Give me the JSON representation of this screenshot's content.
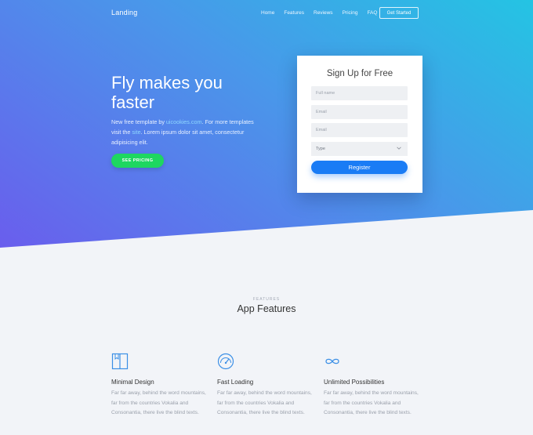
{
  "nav": {
    "brand": "Landing",
    "links": [
      "Home",
      "Features",
      "Reviews",
      "Pricing",
      "FAQ"
    ],
    "cta": "Get Started"
  },
  "hero": {
    "title": "Fly makes you faster",
    "desc_part1": "New free template by ",
    "desc_link1": "uicookies.com",
    "desc_part2": ". For more templates visit the ",
    "desc_link2": "site",
    "desc_part3": ". Lorem ipsum dolor sit amet, consectetur adipisicing elit.",
    "cta": "SEE PRICING"
  },
  "signup": {
    "title": "Sign Up for Free",
    "fields": [
      {
        "placeholder": "Full name"
      },
      {
        "placeholder": "Email"
      },
      {
        "placeholder": "Email"
      }
    ],
    "select_value": "Type",
    "submit": "Register"
  },
  "features": {
    "eyebrow": "FEATURES",
    "title": "App Features",
    "items": [
      {
        "icon": "book-icon",
        "name": "Minimal Design",
        "desc": "Far far away, behind the word mountains, far from the countries Vokalia and Consonantia, there live the blind texts."
      },
      {
        "icon": "speedometer-icon",
        "name": "Fast Loading",
        "desc": "Far far away, behind the word mountains, far from the countries Vokalia and Consonantia, there live the blind texts."
      },
      {
        "icon": "infinity-icon",
        "name": "Unlimited Possibilities",
        "desc": "Far far away, behind the word mountains, far from the countries Vokalia and Consonantia, there live the blind texts."
      }
    ]
  },
  "colors": {
    "accent": "#1a7cf5",
    "cta_green": "#1ed760",
    "icon_blue": "#3b8fe6"
  }
}
